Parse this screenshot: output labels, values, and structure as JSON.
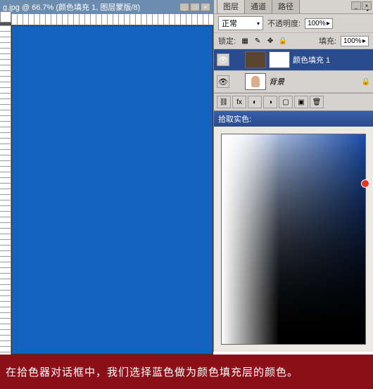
{
  "canvas": {
    "title": "g.jpg @ 66.7% (颜色填充 1, 图层蒙版/8)",
    "fill_color": "#1362bf"
  },
  "tabs": {
    "layers": "图层",
    "channels": "通道",
    "paths": "路径"
  },
  "blend": {
    "mode": "正常",
    "opacity_label": "不透明度:",
    "opacity_value": "100%",
    "lock_label": "锁定:",
    "fill_label": "填充:",
    "fill_value": "100%"
  },
  "layers": [
    {
      "name": "颜色填充 1",
      "selected": true,
      "thumb": "brown",
      "mask": true
    },
    {
      "name": "背景",
      "selected": false,
      "thumb": "person",
      "mask": false
    }
  ],
  "picker": {
    "title": "拾取实色:"
  },
  "caption": "在拾色器对话框中，我们选择蓝色做为颜色填充层的颜色。",
  "win": {
    "min": "_",
    "max": "□",
    "close": "×"
  }
}
